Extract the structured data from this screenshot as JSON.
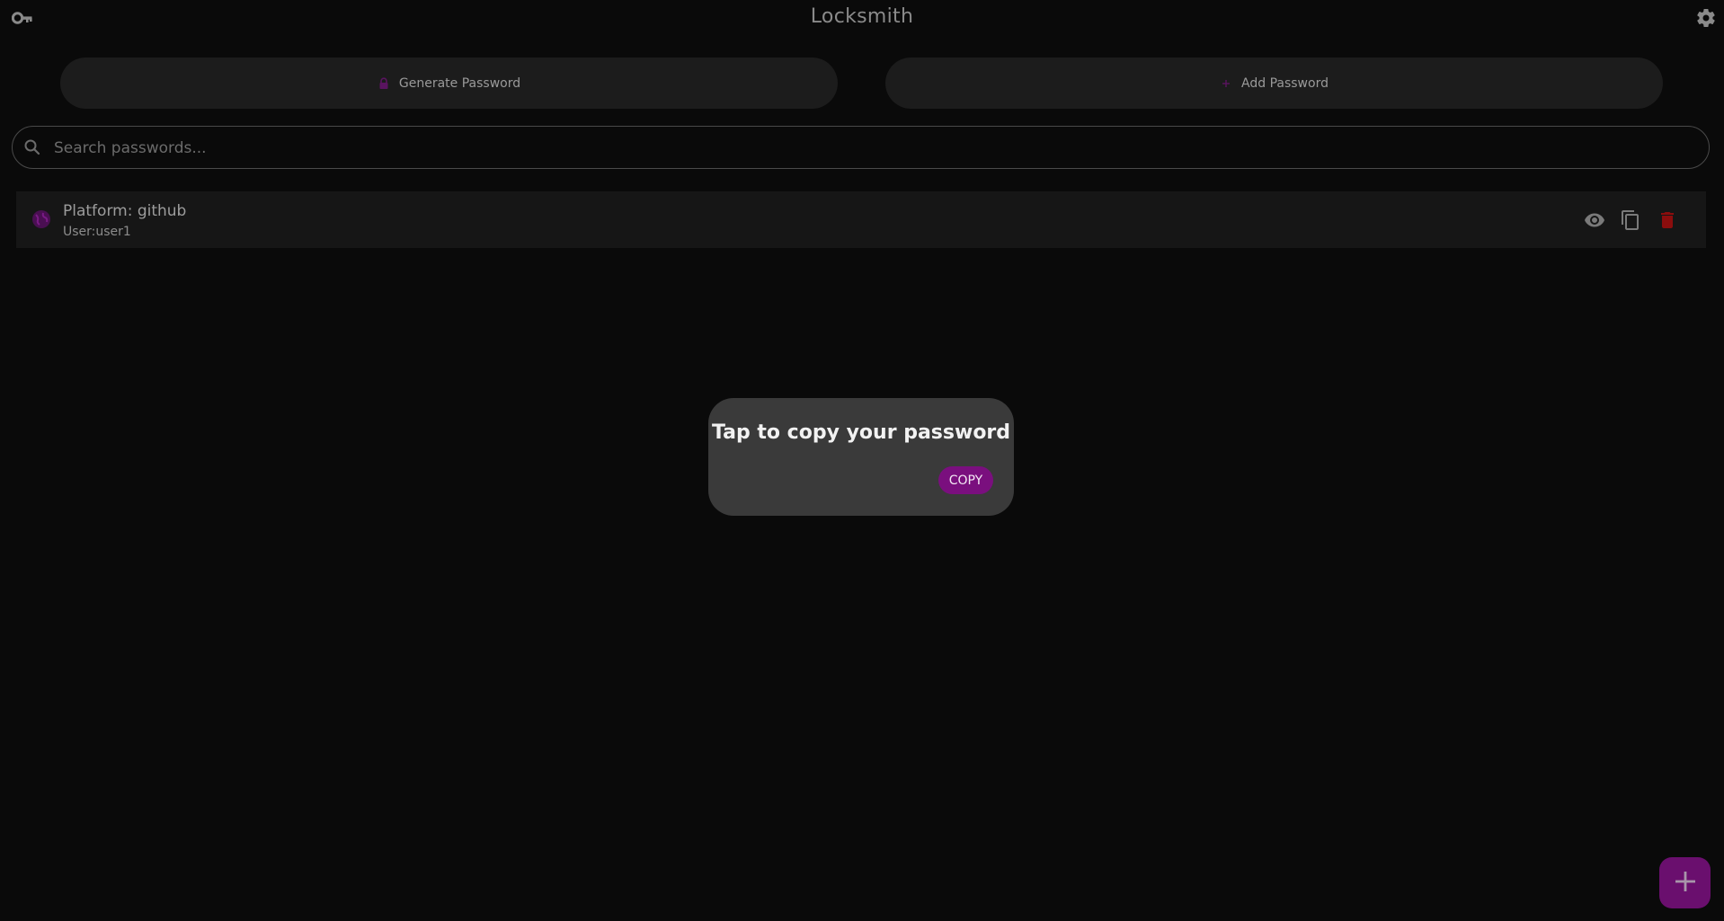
{
  "header": {
    "title": "Locksmith",
    "logo_icon": "key-icon",
    "settings_icon": "gear-icon"
  },
  "actions": {
    "generate_label": "Generate Password",
    "generate_icon": "lock-icon",
    "add_label": "Add Password",
    "add_icon": "plus-icon"
  },
  "search": {
    "placeholder": "Search passwords...",
    "value": "",
    "icon": "search-icon"
  },
  "passwords": [
    {
      "platform": "Platform: github",
      "user": "User:user1",
      "icon": "globe-icon"
    }
  ],
  "dialog": {
    "title": "Tap to copy your password",
    "copy_label": "COPY"
  },
  "fab": {
    "icon": "plus-icon"
  },
  "colors": {
    "background": "#0a0a0a",
    "accent": "#7a0f7e",
    "danger": "#8b0d0d",
    "dialog": "#3a3a3a"
  }
}
